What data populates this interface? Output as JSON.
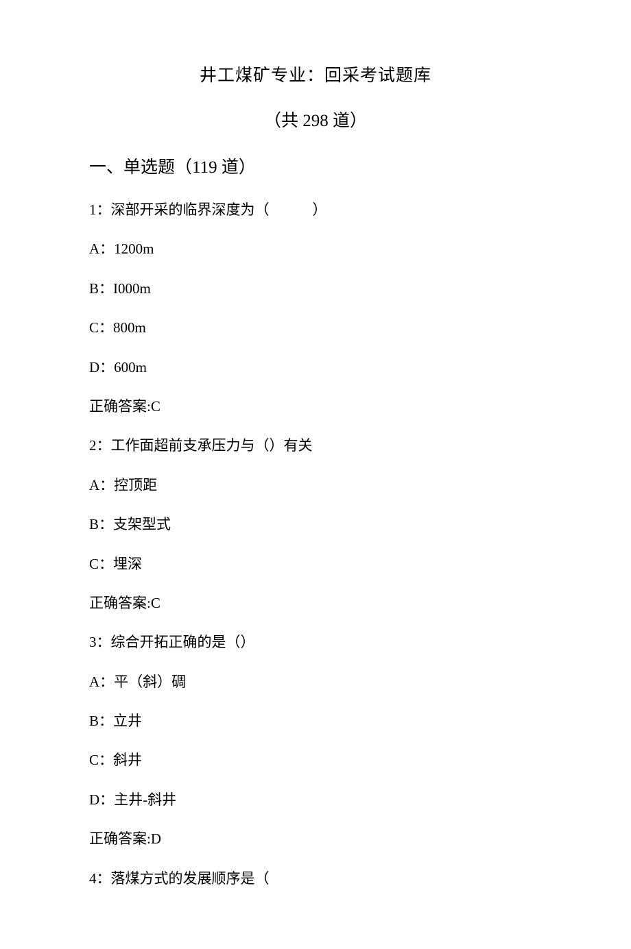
{
  "title": "井工煤矿专业：回采考试题库",
  "subtitle": "（共 298 道）",
  "section_heading": "一、单选题（119 道）",
  "questions": [
    {
      "stem": "1：深部开采的临界深度为（　　　）",
      "options": [
        "A：1200m",
        "B：I000m",
        "C：800m",
        "D：600m"
      ],
      "answer": "正确答案:C"
    },
    {
      "stem": "2：工作面超前支承压力与（）有关",
      "options": [
        "A：控顶距",
        "B：支架型式",
        "C：埋深"
      ],
      "answer": "正确答案:C"
    },
    {
      "stem": "3：综合开拓正确的是（）",
      "options": [
        "A：平（斜）碉",
        "B：立井",
        "C：斜井",
        "D：主井-斜井"
      ],
      "answer": "正确答案:D"
    },
    {
      "stem": "4：落煤方式的发展顺序是（",
      "options": [],
      "answer": ""
    }
  ]
}
